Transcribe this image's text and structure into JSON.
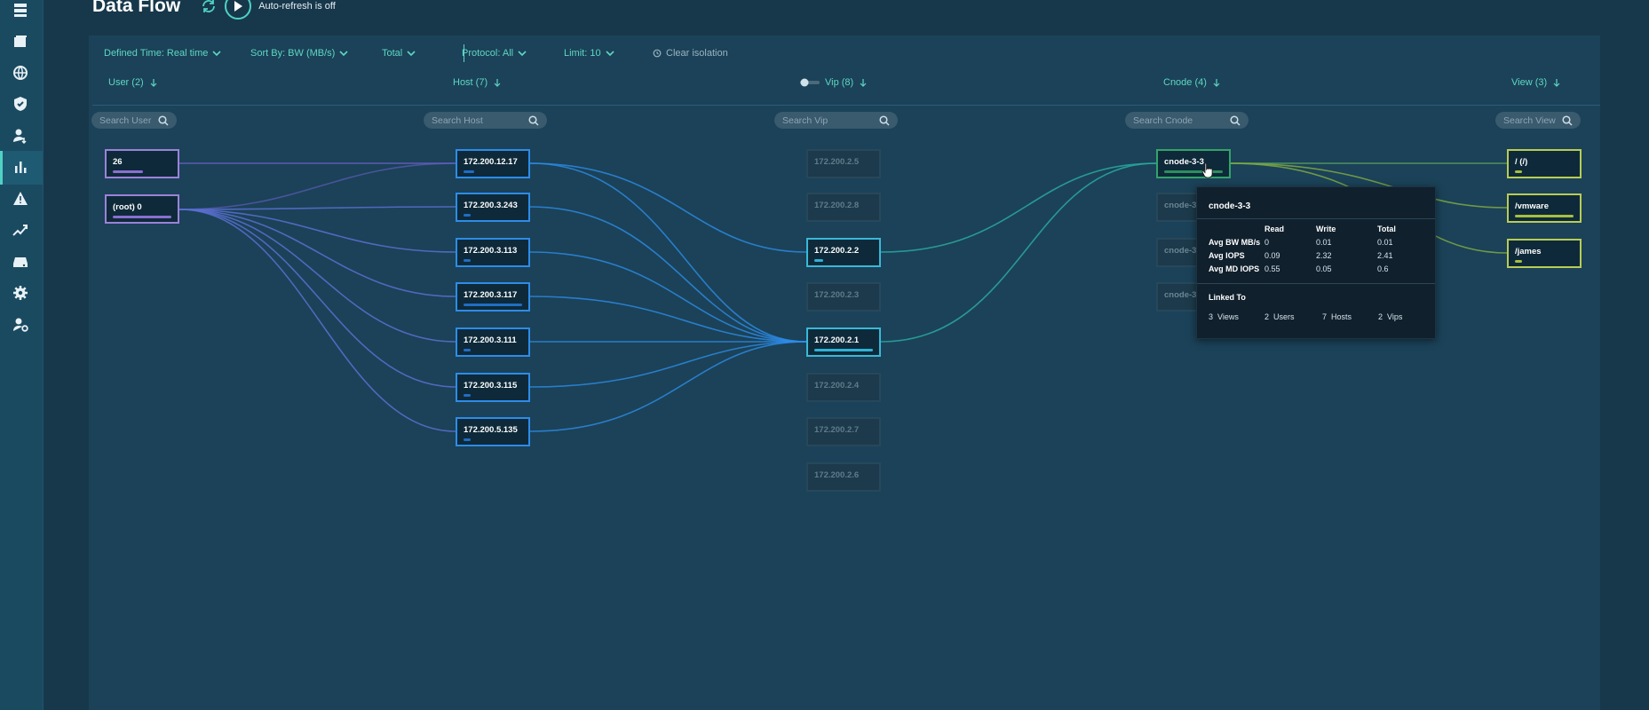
{
  "page": {
    "title": "Data Flow",
    "autorefresh_label": "Auto-refresh is off"
  },
  "sidebar": {
    "icons": [
      "server-icon",
      "folders-icon",
      "globe-icon",
      "shield-icon",
      "user-transfer-icon",
      "bar-chart-icon",
      "alert-icon",
      "trend-icon",
      "drive-icon",
      "gear-icon",
      "user-settings-icon"
    ],
    "active": "bar-chart-icon"
  },
  "filters": {
    "defined_time": "Defined Time: Real time",
    "sort_by": "Sort By:  BW (MB/s)",
    "total": "Total",
    "protocol": "Protocol:  All",
    "limit": "Limit:  10",
    "clear": "Clear isolation"
  },
  "columns": {
    "user": {
      "label": "User (2)",
      "placeholder": "Search User",
      "nodes": [
        "26",
        "(root) 0"
      ]
    },
    "host": {
      "label": "Host (7)",
      "placeholder": "Search Host",
      "nodes": [
        "172.200.12.17",
        "172.200.3.243",
        "172.200.3.113",
        "172.200.3.117",
        "172.200.3.111",
        "172.200.3.115",
        "172.200.5.135"
      ]
    },
    "vip": {
      "label": "Vip (8)",
      "placeholder": "Search Vip",
      "nodes": [
        "172.200.2.5",
        "172.200.2.8",
        "172.200.2.2",
        "172.200.2.3",
        "172.200.2.1",
        "172.200.2.4",
        "172.200.2.7",
        "172.200.2.6"
      ]
    },
    "cnode": {
      "label": "Cnode (4)",
      "placeholder": "Search Cnode",
      "nodes": [
        "cnode-3-3",
        "cnode-3-",
        "cnode-3-",
        "cnode-3-"
      ]
    },
    "view": {
      "label": "View (3)",
      "placeholder": "Search View",
      "nodes": [
        "/ (/)",
        "/vmware",
        "/james"
      ]
    }
  },
  "tooltip": {
    "title": "cnode-3-3",
    "headers": [
      "Read",
      "Write",
      "Total"
    ],
    "rows": [
      {
        "label": "Avg BW MB/s",
        "values": [
          "0",
          "0.01",
          "0.01"
        ]
      },
      {
        "label": "Avg IOPS",
        "values": [
          "0.09",
          "2.32",
          "2.41"
        ]
      },
      {
        "label": "Avg MD IOPS",
        "values": [
          "0.55",
          "0.05",
          "0.6"
        ]
      }
    ],
    "linked_label": "Linked To",
    "linked": [
      {
        "count": "3",
        "label": "Views"
      },
      {
        "count": "2",
        "label": "Users"
      },
      {
        "count": "7",
        "label": "Hosts"
      },
      {
        "count": "2",
        "label": "Vips"
      }
    ]
  },
  "colors": {
    "accent": "#4fd1c5",
    "user": "#9b82d8",
    "host": "#2d8ce8",
    "vip": "#3ab8d8",
    "cnode": "#34a36a",
    "view": "#b9cc55"
  }
}
